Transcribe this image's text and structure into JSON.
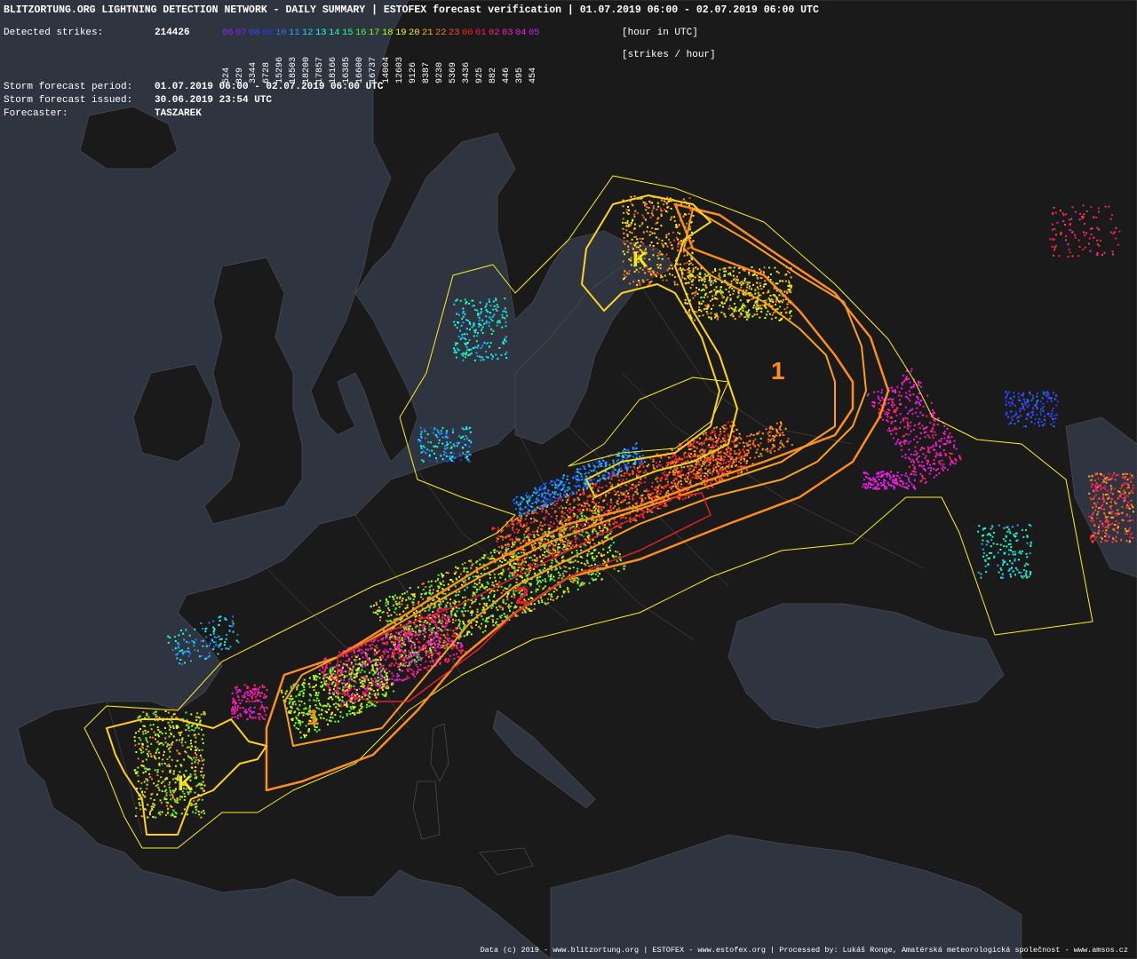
{
  "header": {
    "title": "BLITZORTUNG.ORG LIGHTNING DETECTION NETWORK - DAILY SUMMARY | ESTOFEX forecast verification | 01.07.2019 06:00 - 02.07.2019 06:00 UTC",
    "detected_label": "Detected strikes:",
    "detected_value": "214426",
    "hour_unit": "[hour in UTC]",
    "rate_unit": "[strikes / hour]",
    "period_label": "Storm forecast period:",
    "period_value": "01.07.2019 06:00 - 02.07.2019 06:00 UTC",
    "issued_label": "Storm forecast issued:",
    "issued_value": "30.06.2019 23:54 UTC",
    "forecaster_label": "Forecaster:",
    "forecaster_value": "TASZAREK"
  },
  "hours": [
    {
      "h": "06",
      "color": "#9a22ff",
      "count": "524"
    },
    {
      "h": "07",
      "color": "#7a22ff",
      "count": "829"
    },
    {
      "h": "08",
      "color": "#4a3cff",
      "count": "3344"
    },
    {
      "h": "09",
      "color": "#1e3cff",
      "count": "6728"
    },
    {
      "h": "10",
      "color": "#1e78ff",
      "count": "15296"
    },
    {
      "h": "11",
      "color": "#1ea8ff",
      "count": "18503"
    },
    {
      "h": "12",
      "color": "#1ed2ff",
      "count": "18200"
    },
    {
      "h": "13",
      "color": "#1effee",
      "count": "17857"
    },
    {
      "h": "14",
      "color": "#1effc0",
      "count": "18166"
    },
    {
      "h": "15",
      "color": "#1eff8a",
      "count": "16385"
    },
    {
      "h": "16",
      "color": "#3cff3c",
      "count": "16600"
    },
    {
      "h": "17",
      "color": "#78ff1e",
      "count": "16737"
    },
    {
      "h": "18",
      "color": "#b4ff1e",
      "count": "14004"
    },
    {
      "h": "19",
      "color": "#e6ff1e",
      "count": "12603"
    },
    {
      "h": "20",
      "color": "#ffe61e",
      "count": "9126"
    },
    {
      "h": "21",
      "color": "#ffb41e",
      "count": "8387"
    },
    {
      "h": "22",
      "color": "#ff7a1e",
      "count": "9230"
    },
    {
      "h": "23",
      "color": "#ff4a1e",
      "count": "5369"
    },
    {
      "h": "00",
      "color": "#ff1e1e",
      "count": "3436"
    },
    {
      "h": "01",
      "color": "#ff1e50",
      "count": "925"
    },
    {
      "h": "02",
      "color": "#ff1e8a",
      "count": "882"
    },
    {
      "h": "03",
      "color": "#ff1ec8",
      "count": "446"
    },
    {
      "h": "04",
      "color": "#f01ef0",
      "count": "395"
    },
    {
      "h": "05",
      "color": "#c81ef0",
      "count": "454"
    }
  ],
  "map_labels": [
    {
      "text": "1",
      "color": "#ff8c1e"
    },
    {
      "text": "2",
      "color": "#e41e2a"
    },
    {
      "text": "1",
      "color": "#ff8c1e"
    },
    {
      "text": "K",
      "color": "#f5e61e"
    },
    {
      "text": "K",
      "color": "#f5e61e"
    }
  ],
  "footer": "Data (c) 2019 - www.blitzortung.org | ESTOFEX - www.estofex.org | Processed by: Lukáš Ronge, Amatérská meteorologická společnost - www.amsos.cz",
  "colors": {
    "sea": "#2e3440",
    "land": "#1a1a1a",
    "level1": "#ff8c1e",
    "level2": "#e41e2a",
    "lightning_area": "#ffee22",
    "thunderstorm_area": "#fff03c"
  }
}
